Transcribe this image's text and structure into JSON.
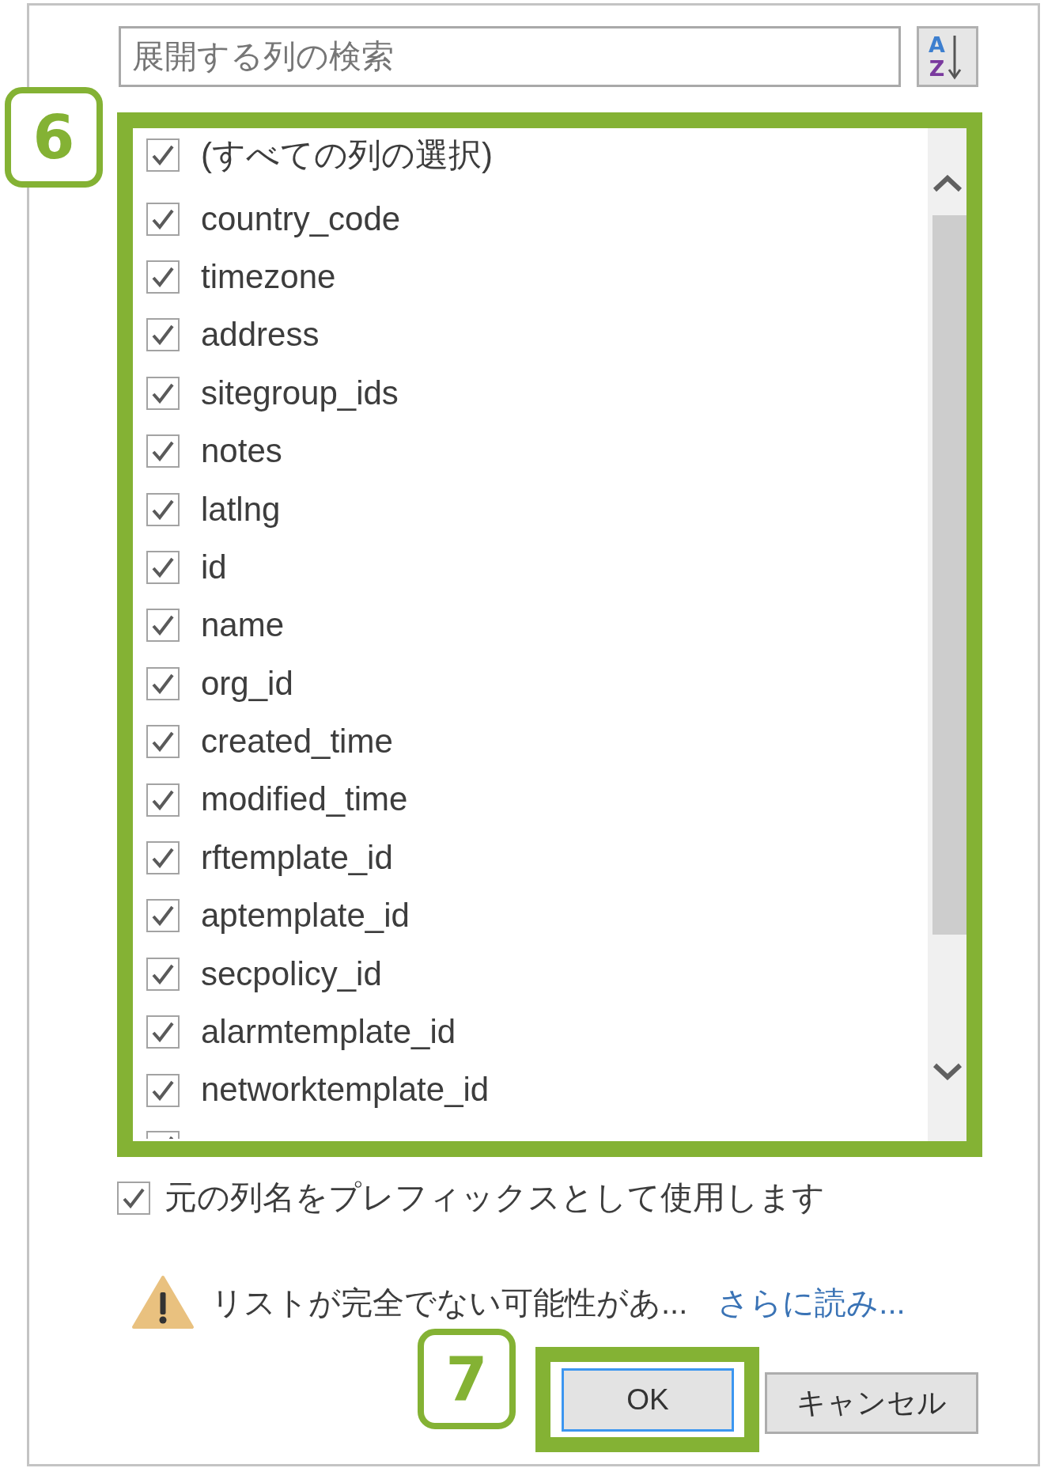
{
  "search": {
    "placeholder": "展開する列の検索"
  },
  "sort_button": {
    "top_letter": "A",
    "bottom_letter": "Z"
  },
  "column_list": {
    "highlighted": true,
    "annotation": "6",
    "select_all": {
      "label": "(すべての列の選択)",
      "checked": true
    },
    "columns": [
      {
        "label": "country_code",
        "checked": true
      },
      {
        "label": "timezone",
        "checked": true
      },
      {
        "label": "address",
        "checked": true
      },
      {
        "label": "sitegroup_ids",
        "checked": true
      },
      {
        "label": "notes",
        "checked": true
      },
      {
        "label": "latlng",
        "checked": true
      },
      {
        "label": "id",
        "checked": true
      },
      {
        "label": "name",
        "checked": true
      },
      {
        "label": "org_id",
        "checked": true
      },
      {
        "label": "created_time",
        "checked": true
      },
      {
        "label": "modified_time",
        "checked": true
      },
      {
        "label": "rftemplate_id",
        "checked": true
      },
      {
        "label": "aptemplate_id",
        "checked": true
      },
      {
        "label": "secpolicy_id",
        "checked": true
      },
      {
        "label": "alarmtemplate_id",
        "checked": true
      },
      {
        "label": "networktemplate_id",
        "checked": true
      }
    ],
    "partial_row": {
      "checked": true
    }
  },
  "prefix_option": {
    "label": "元の列名をプレフィックスとして使用します",
    "checked": true
  },
  "warning": {
    "message": "リストが完全でない可能性があ...",
    "link": "さらに読み..."
  },
  "buttons": [
    {
      "label": "OK",
      "focused": true,
      "highlighted": true,
      "annotation": "7"
    },
    {
      "label": "キャンセル",
      "focused": false,
      "highlighted": false
    }
  ]
}
